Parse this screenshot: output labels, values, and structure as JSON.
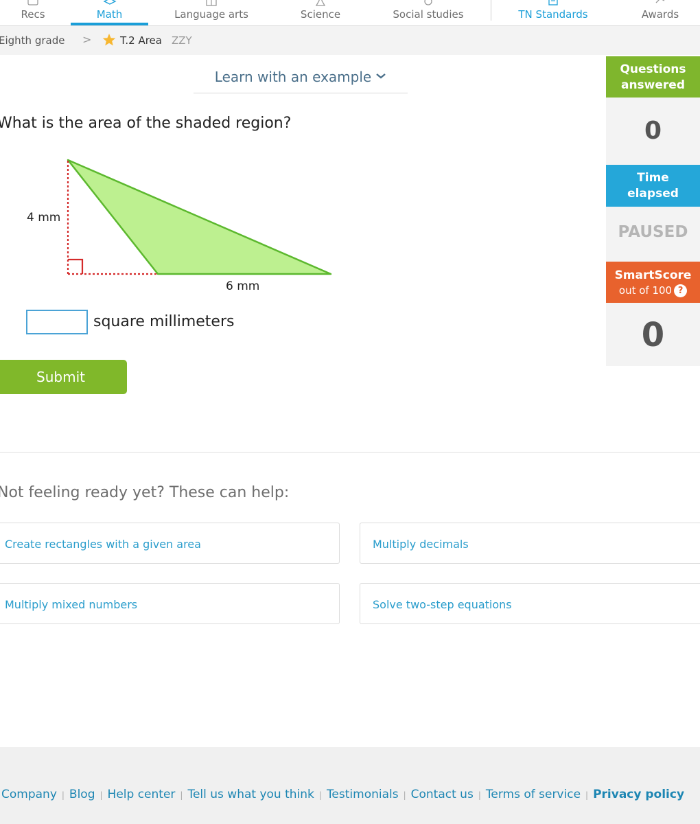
{
  "nav": {
    "tabs": [
      {
        "label": "Recs",
        "icon": "recs-icon"
      },
      {
        "label": "Math",
        "icon": "math-icon",
        "active": true
      },
      {
        "label": "Language arts",
        "icon": "book-icon"
      },
      {
        "label": "Science",
        "icon": "flask-icon"
      },
      {
        "label": "Social studies",
        "icon": "globe-icon"
      },
      {
        "label": "TN Standards",
        "icon": "standards-icon"
      },
      {
        "label": "Awards",
        "icon": "awards-icon"
      }
    ]
  },
  "breadcrumb": {
    "grade": "Eighth grade",
    "separator": ">",
    "skill": "T.2 Area",
    "code": "ZZY"
  },
  "learn": {
    "label": "Learn with an example"
  },
  "question": {
    "text": "What is the area of the shaded region?",
    "height_label": "4 mm",
    "base_label": "6 mm",
    "answer_value": "",
    "unit": "square millimeters",
    "submit_label": "Submit"
  },
  "sidebar": {
    "questions_label_1": "Questions",
    "questions_label_2": "answered",
    "questions_value": "0",
    "time_label_1": "Time",
    "time_label_2": "elapsed",
    "time_value": "PAUSED",
    "smartscore_label": "SmartScore",
    "smartscore_sub": "out of 100",
    "smartscore_help": "?",
    "smartscore_value": "0"
  },
  "help": {
    "title": "Not feeling ready yet? These can help:",
    "links": [
      "Create rectangles with a given area",
      "Multiply decimals",
      "Multiply mixed numbers",
      "Solve two-step equations"
    ]
  },
  "footer": {
    "links": [
      "Company",
      "Blog",
      "Help center",
      "Tell us what you think",
      "Testimonials",
      "Contact us",
      "Terms of service",
      "Privacy policy"
    ],
    "separator": "|"
  },
  "colors": {
    "accent_blue": "#1a9ed8",
    "submit_green": "#80b82a",
    "questions_green": "#7fb62d",
    "time_blue": "#25a7d9",
    "smartscore_orange": "#e8622d",
    "shape_fill": "#bdf090",
    "shape_stroke": "#5cb82e",
    "dotted_red": "#d42a2a"
  }
}
